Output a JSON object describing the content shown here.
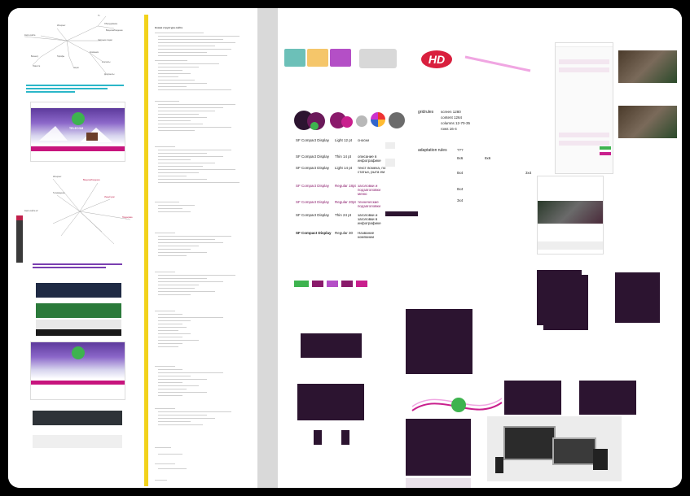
{
  "typography": {
    "rows": [
      {
        "font": "SF Compact Display",
        "style": "Light 12 pt",
        "usage": "сноски",
        "accent": false
      },
      {
        "font": "SF Compact Display",
        "style": "Thin 14 pt",
        "usage": "описание в инфографике",
        "accent": false
      },
      {
        "font": "SF Compact Display",
        "style": "Light 14 pt",
        "usage": "текст всмеха, по статьи, рыта ем",
        "accent": false
      },
      {
        "font": "SF Compact Display",
        "style": "Regular 18pt",
        "usage": "заголовки и подзаголовки меню",
        "accent": true
      },
      {
        "font": "SF Compact Display",
        "style": "Regular 20pt",
        "usage": "технические подзаголовки",
        "accent": true
      },
      {
        "font": "SF Compact Display",
        "style": "Thin 24 pt",
        "usage": "заголовки и заголовки в инфографике",
        "accent": false
      },
      {
        "font": "SF Compact Display",
        "style": "Regular 30",
        "usage": "Название компании",
        "accent": false
      }
    ]
  },
  "grid": {
    "title": "gridrules",
    "values": [
      "screen 1280",
      "content 1264",
      "columns 12-70-35",
      "rows 16-4"
    ]
  },
  "adaptation": {
    "title": "adaptation rules",
    "marker": "???",
    "ratios": [
      "8x6",
      "8x6",
      "8x4",
      "3x4",
      "8x4",
      "3x4"
    ]
  },
  "badge": {
    "text": "HD"
  },
  "colors": {
    "accent": "#8a1a6b",
    "dark": "#2c1430",
    "yellow": "#f2d21c",
    "green": "#3eb34f",
    "swatches": [
      "#2c1430",
      "#8a1a6b",
      "#6b1a5a",
      "#b8b8b8",
      "#e8c3e0",
      "#6b6b6b"
    ]
  },
  "left_panel": {
    "brand_text": "TELECOM",
    "snow_label": "winter banner",
    "footer_label": "footer"
  },
  "doc_panel": {
    "heading": "Новая структура сайта"
  }
}
